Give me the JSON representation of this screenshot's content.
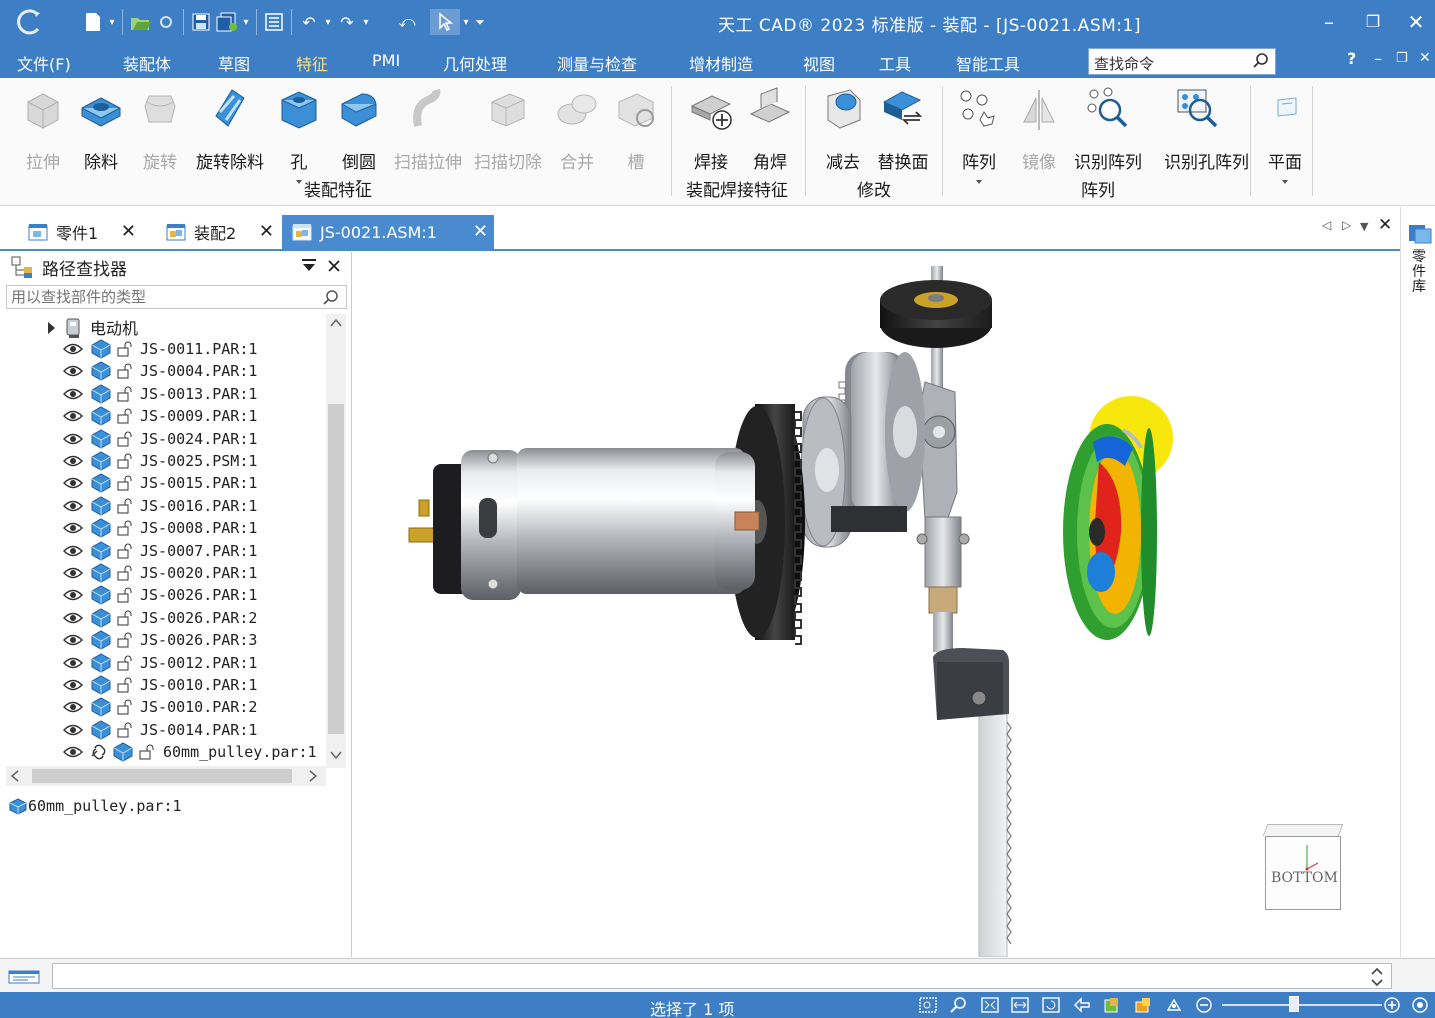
{
  "titlebar": {
    "title": "天工 CAD® 2023 标准版 - 装配 - [JS-0021.ASM:1]",
    "minimize": "–",
    "restore": "❐",
    "close": "✕"
  },
  "menu": {
    "items": [
      "文件(F)",
      "装配体",
      "草图",
      "特征",
      "PMI",
      "几何处理",
      "测量与检查",
      "增材制造",
      "视图",
      "工具",
      "智能工具"
    ],
    "active_index": 3,
    "search_placeholder": "查找命令",
    "help": "?",
    "mini_minimize": "–",
    "mini_restore": "❐",
    "mini_close": "✕"
  },
  "ribbon": {
    "buttons": [
      {
        "label": "拉伸",
        "enabled": false
      },
      {
        "label": "除料",
        "enabled": true
      },
      {
        "label": "旋转",
        "enabled": false
      },
      {
        "label": "旋转除料",
        "enabled": true
      },
      {
        "label": "孔",
        "enabled": true
      },
      {
        "label": "倒圆",
        "enabled": true
      },
      {
        "label": "扫描拉伸",
        "enabled": false
      },
      {
        "label": "扫描切除",
        "enabled": false
      },
      {
        "label": "合并",
        "enabled": false
      },
      {
        "label": "槽",
        "enabled": false
      },
      {
        "label": "焊接",
        "enabled": true
      },
      {
        "label": "角焊",
        "enabled": true
      },
      {
        "label": "减去",
        "enabled": true
      },
      {
        "label": "替换面",
        "enabled": true
      },
      {
        "label": "阵列",
        "enabled": true
      },
      {
        "label": "镜像",
        "enabled": false
      },
      {
        "label": "识别阵列",
        "enabled": true
      },
      {
        "label": "识别孔阵列",
        "enabled": true
      },
      {
        "label": "平面",
        "enabled": true
      }
    ],
    "groups": [
      "装配特征",
      "装配焊接特征",
      "修改",
      "阵列"
    ]
  },
  "tabs": [
    {
      "label": "零件1",
      "close": "✕",
      "active": false
    },
    {
      "label": "装配2",
      "close": "✕",
      "active": false
    },
    {
      "label": "JS-0021.ASM:1",
      "close": "✕",
      "active": true
    }
  ],
  "tab_nav": {
    "prev": "◁",
    "next": "▷",
    "list": "▼",
    "close": "✕"
  },
  "right_strip": {
    "label": "零件库"
  },
  "pathfinder": {
    "title": "路径查找器",
    "search_placeholder": "用以查找部件的类型",
    "root": "电动机",
    "items": [
      "JS-0011.PAR:1",
      "JS-0004.PAR:1",
      "JS-0013.PAR:1",
      "JS-0009.PAR:1",
      "JS-0024.PAR:1",
      "JS-0025.PSM:1",
      "JS-0015.PAR:1",
      "JS-0016.PAR:1",
      "JS-0008.PAR:1",
      "JS-0007.PAR:1",
      "JS-0020.PAR:1",
      "JS-0026.PAR:1",
      "JS-0026.PAR:2",
      "JS-0026.PAR:3",
      "JS-0012.PAR:1",
      "JS-0010.PAR:1",
      "JS-0010.PAR:2",
      "JS-0014.PAR:1"
    ],
    "last_item": "60mm_pulley.par:1",
    "selected": "60mm_pulley.par:1"
  },
  "viewcube": {
    "label": "BOTTOM"
  },
  "status": {
    "text": "选择了 1 项",
    "zoom_level": 0.45
  },
  "colors": {
    "accent": "#3d7ec5",
    "tab_active": "#4a8bd0",
    "menu_active": "#ffe17a"
  }
}
